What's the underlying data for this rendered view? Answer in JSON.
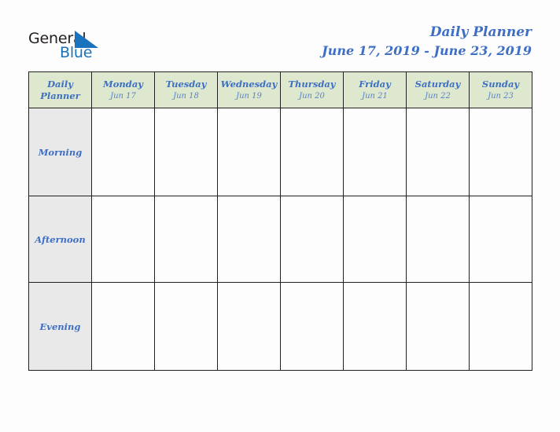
{
  "brand": {
    "word_one": "General",
    "word_two": "Blue",
    "triangle_icon": "triangle-icon",
    "color_dark": "#231f20",
    "color_blue": "#1a72bd"
  },
  "header": {
    "title": "Daily Planner",
    "date_range": "June 17, 2019 - June 23, 2019",
    "title_color": "#3e6fc4"
  },
  "table": {
    "corner": {
      "line1": "Daily",
      "line2": "Planner"
    },
    "header_bg": "#dde8ce",
    "row_label_bg": "#e9e9e9",
    "border_color": "#231f20",
    "columns": [
      {
        "day": "Monday",
        "date": "Jun 17"
      },
      {
        "day": "Tuesday",
        "date": "Jun 18"
      },
      {
        "day": "Wednesday",
        "date": "Jun 19"
      },
      {
        "day": "Thursday",
        "date": "Jun 20"
      },
      {
        "day": "Friday",
        "date": "Jun 21"
      },
      {
        "day": "Saturday",
        "date": "Jun 22"
      },
      {
        "day": "Sunday",
        "date": "Jun 23"
      }
    ],
    "rows": [
      {
        "label": "Morning",
        "cells": [
          "",
          "",
          "",
          "",
          "",
          "",
          ""
        ]
      },
      {
        "label": "Afternoon",
        "cells": [
          "",
          "",
          "",
          "",
          "",
          "",
          ""
        ]
      },
      {
        "label": "Evening",
        "cells": [
          "",
          "",
          "",
          "",
          "",
          "",
          ""
        ]
      }
    ]
  }
}
